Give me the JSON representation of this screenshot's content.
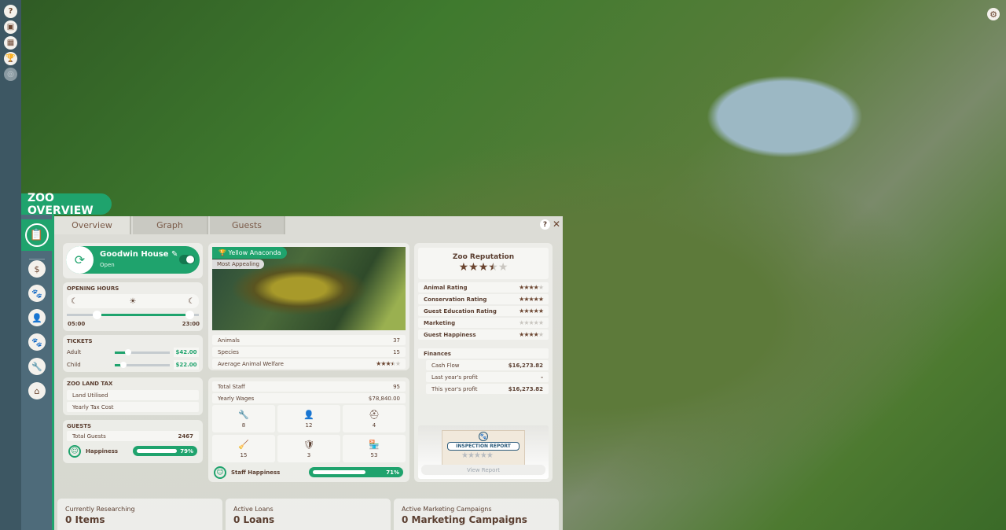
{
  "hud": {
    "left_icons": [
      {
        "icon": "help-icon",
        "glyph": "?"
      },
      {
        "icon": "zoo-overview-icon",
        "glyph": "▣"
      },
      {
        "icon": "calendar-icon",
        "glyph": "▦"
      },
      {
        "icon": "trophy-icon",
        "glyph": "🏆"
      },
      {
        "icon": "disabled-icon",
        "glyph": "◎"
      }
    ],
    "settings_icon": "⚙"
  },
  "window": {
    "title": "ZOO OVERVIEW",
    "tabs": [
      {
        "label": "Overview",
        "active": true
      },
      {
        "label": "Graph"
      },
      {
        "label": "Guests"
      }
    ],
    "help": "?",
    "close": "✕"
  },
  "side_icons": [
    {
      "icon": "finance-icon",
      "glyph": "$"
    },
    {
      "icon": "paw-icon",
      "glyph": "🐾"
    },
    {
      "icon": "staff-icon",
      "glyph": "👤"
    },
    {
      "icon": "animals-icon",
      "glyph": "🐾"
    },
    {
      "icon": "maintenance-icon",
      "glyph": "🔧"
    },
    {
      "icon": "shop-icon",
      "glyph": "⌂"
    }
  ],
  "zoo": {
    "name": "Goodwin House",
    "status": "Open",
    "open": true
  },
  "hours": {
    "label": "OPENING HOURS",
    "open": "05:00",
    "close": "23:00"
  },
  "tickets": {
    "label": "TICKETS",
    "adult_label": "Adult",
    "adult": "$42.00",
    "child_label": "Child",
    "child": "$22.00"
  },
  "tax": {
    "label": "ZOO LAND TAX",
    "land": "Land Utilised",
    "yearly": "Yearly Tax Cost"
  },
  "guests": {
    "label": "GUESTS",
    "total_label": "Total Guests",
    "total": "2467",
    "happiness_label": "Happiness",
    "happiness": "79%",
    "happiness_pct": 79
  },
  "animals": {
    "featured": "Yellow Anaconda",
    "featured_tag": "Most Appealing",
    "animals_label": "Animals",
    "animals": "37",
    "species_label": "Species",
    "species": "15",
    "welfare_label": "Average Animal Welfare",
    "welfare_stars": 3.5
  },
  "staff": {
    "total_label": "Total Staff",
    "total": "95",
    "wages_label": "Yearly Wages",
    "wages": "$78,840.00",
    "types": [
      {
        "icon": "mechanic-icon",
        "glyph": "🔧",
        "count": "8"
      },
      {
        "icon": "zookeeper-icon",
        "glyph": "👤",
        "count": "12"
      },
      {
        "icon": "vet-icon",
        "glyph": "⛑",
        "count": "4"
      },
      {
        "icon": "janitor-icon",
        "glyph": "🧹",
        "count": "15"
      },
      {
        "icon": "security-icon",
        "glyph": "🛡",
        "count": "3"
      },
      {
        "icon": "vendor-icon",
        "glyph": "🏪",
        "count": "53"
      }
    ],
    "happiness_label": "Staff Happiness",
    "happiness": "71%",
    "happiness_pct": 71
  },
  "reputation": {
    "title": "Zoo Reputation",
    "stars": 3.5,
    "ratings": [
      {
        "label": "Animal Rating",
        "stars": 4
      },
      {
        "label": "Conservation Rating",
        "stars": 5
      },
      {
        "label": "Guest Education Rating",
        "stars": 5
      },
      {
        "label": "Marketing",
        "stars": 0
      },
      {
        "label": "Guest Happiness",
        "stars": 4
      }
    ]
  },
  "finances": {
    "label": "Finances",
    "rows": [
      {
        "label": "Cash Flow",
        "value": "$16,273.82"
      },
      {
        "label": "Last year's profit",
        "value": "-"
      },
      {
        "label": "This year's profit",
        "value": "$16,273.82"
      }
    ]
  },
  "inspection": {
    "title": "INSPECTION REPORT",
    "button": "View Report"
  },
  "summary": [
    {
      "label": "Currently Researching",
      "value": "0 Items"
    },
    {
      "label": "Active Loans",
      "value": "0 Loans"
    },
    {
      "label": "Active Marketing Campaigns",
      "value": "0 Marketing Campaigns"
    }
  ],
  "colors": {
    "accent": "#1fa36d",
    "text": "#5a3e30",
    "sidebar": "#4e6b7a"
  }
}
